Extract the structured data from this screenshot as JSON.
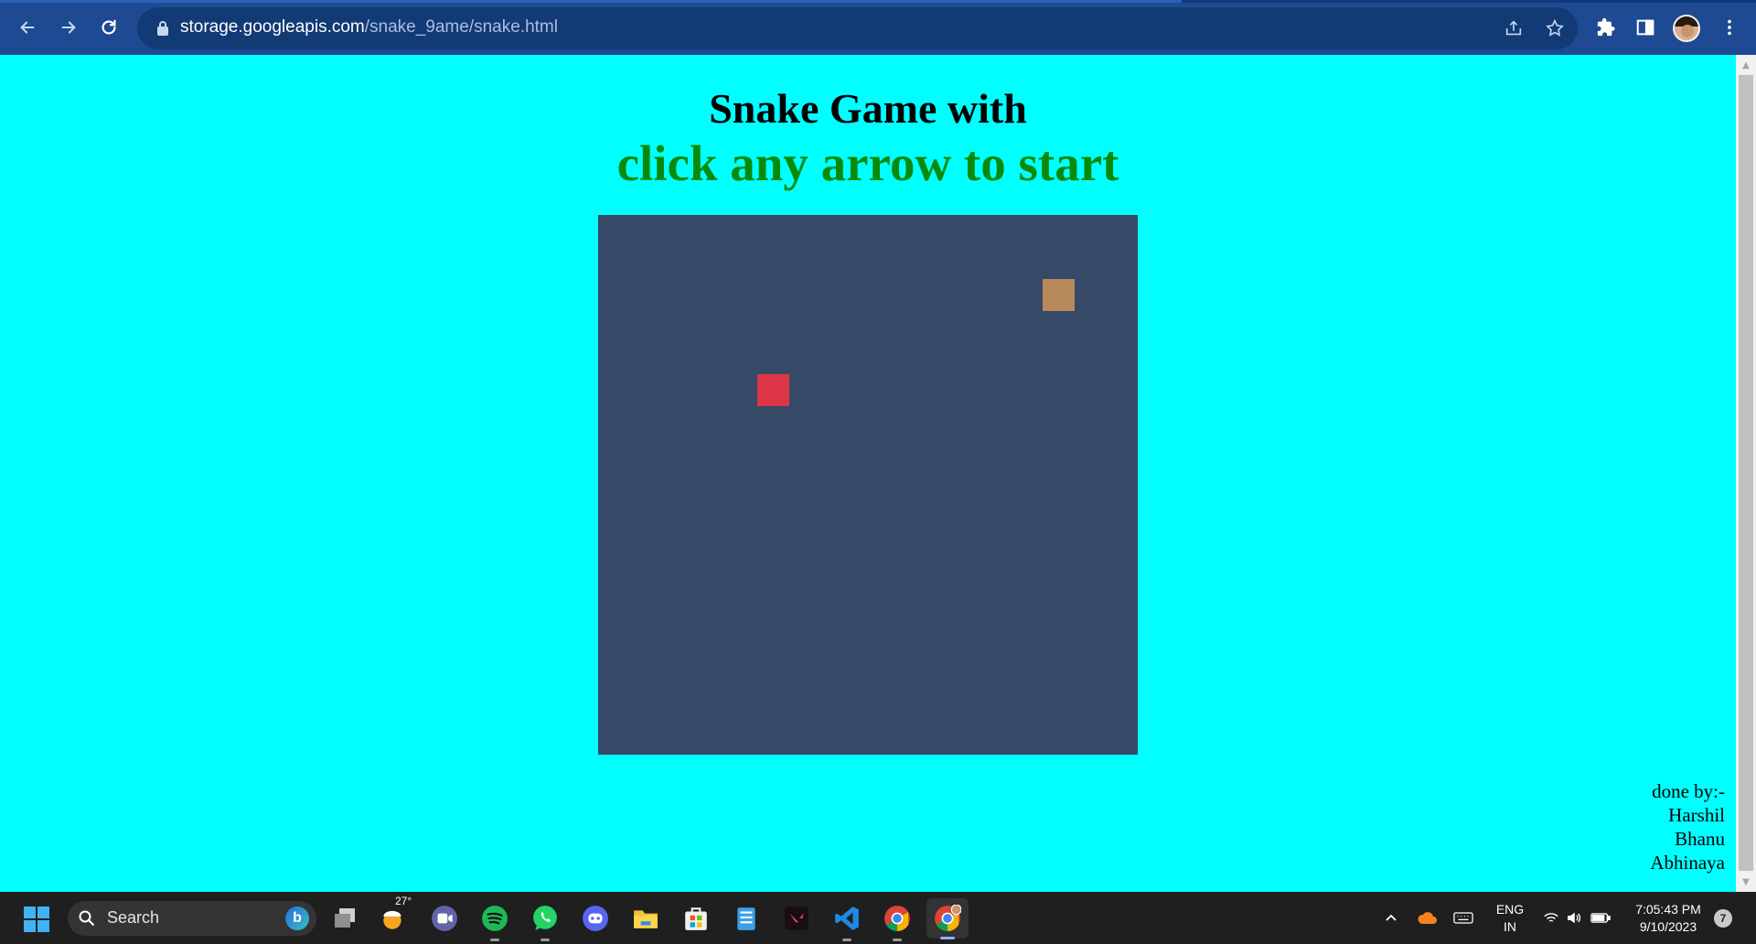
{
  "browser": {
    "url_host": "storage.googleapis.com",
    "url_path": "/snake_9ame/snake.html",
    "icons": [
      "back-icon",
      "forward-icon",
      "reload-icon",
      "lock-icon",
      "share-icon",
      "star-icon",
      "extensions-icon",
      "side-panel-icon",
      "profile-avatar",
      "more-menu-icon"
    ]
  },
  "page": {
    "title": "Snake Game with",
    "subtitle": "click any arrow to start",
    "credits": {
      "heading": "done by:-",
      "names": [
        "Harshil",
        "Bhanu",
        "Abhinaya"
      ]
    },
    "colors": {
      "background": "#00ffff",
      "subtitle": "#0a8a0a",
      "board": "#364966",
      "food": "#dc3545",
      "snake": "#b8895a"
    }
  },
  "taskbar": {
    "search_label": "Search",
    "weather_temp": "27°",
    "apps": [
      "widgets-weather",
      "task-view",
      "teams",
      "spotify",
      "whatsapp",
      "discord",
      "file-explorer",
      "microsoft-store",
      "notepad",
      "valorant",
      "vs-code",
      "chrome",
      "chrome-profile"
    ],
    "language_line1": "ENG",
    "language_line2": "IN",
    "time": "7:05:43 PM",
    "date": "9/10/2023",
    "notification_count": "7"
  }
}
